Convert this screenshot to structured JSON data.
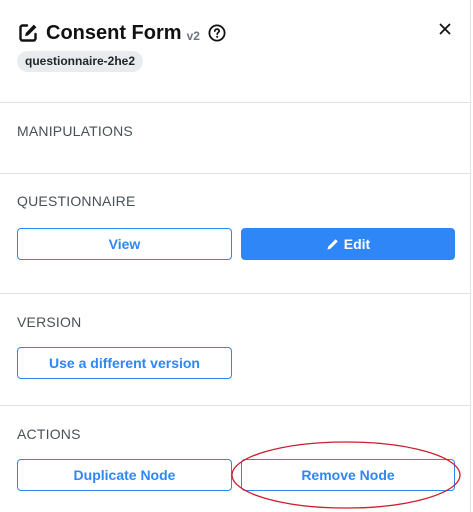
{
  "header": {
    "title": "Consent Form",
    "version": "v2",
    "badge": "questionnaire-2he2",
    "close_symbol": "×"
  },
  "sections": {
    "manipulations": {
      "title": "MANIPULATIONS"
    },
    "questionnaire": {
      "title": "QUESTIONNAIRE",
      "view_label": "View",
      "edit_label": "Edit"
    },
    "version": {
      "title": "VERSION",
      "change_label": "Use a different version"
    },
    "actions": {
      "title": "ACTIONS",
      "duplicate_label": "Duplicate Node",
      "remove_label": "Remove Node"
    }
  },
  "icons": {
    "title": "edit-icon",
    "help": "question-circle-icon",
    "close": "close-icon",
    "edit_button": "pencil-icon"
  },
  "colors": {
    "accent": "#2f86f6",
    "badge_bg": "#e9ecef",
    "annotation": "#cc1f2f"
  }
}
